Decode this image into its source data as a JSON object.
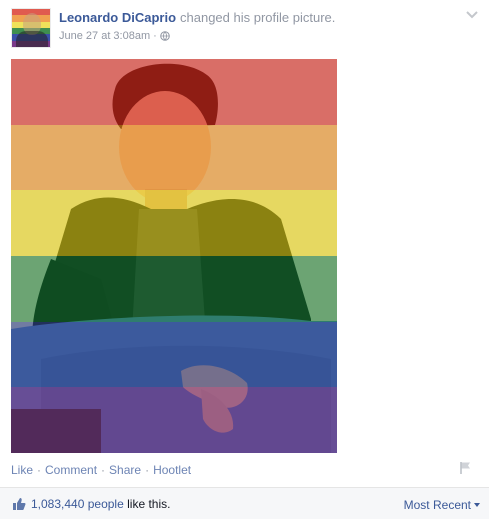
{
  "post": {
    "author": "Leonardo DiCaprio",
    "action": "changed his profile picture.",
    "timestamp": "June 27 at 3:08am",
    "meta_separator": "·",
    "privacy_icon": "globe-icon",
    "menu_icon": "chevron-down-icon"
  },
  "photo": {
    "overlay": "rainbow-flag",
    "flag_colors": [
      "#e40303",
      "#ff8c00",
      "#ffed00",
      "#008026",
      "#24408e",
      "#732982"
    ]
  },
  "actions": {
    "like": "Like",
    "comment": "Comment",
    "share": "Share",
    "hootlet": "Hootlet",
    "separator": "·",
    "report_icon": "flag-icon"
  },
  "likes": {
    "count": "1,083,440 people",
    "suffix": "like this.",
    "sort_label": "Most Recent",
    "thumb_icon": "thumbs-up-icon"
  },
  "colors": {
    "link_blue": "#3b5998",
    "muted_grey": "#9197a3",
    "action_link": "#6d84b4",
    "bar_bg": "#f6f7f9"
  }
}
